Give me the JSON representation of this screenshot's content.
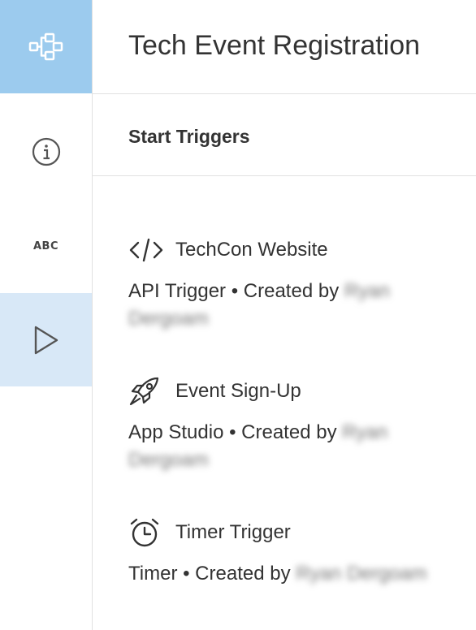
{
  "rail": {
    "items": [
      {
        "name": "workflow-icon",
        "selected": true
      },
      {
        "name": "info-icon",
        "selected": false
      },
      {
        "name": "abc-icon",
        "label": "ABC",
        "selected": false
      },
      {
        "name": "play-icon",
        "selected": true
      }
    ],
    "colors": {
      "active": "#9ccbee",
      "highlight": "#d8e8f7"
    }
  },
  "header": {
    "title": "Tech Event Registration"
  },
  "section": {
    "title": "Start Triggers"
  },
  "triggers": [
    {
      "icon": "code-icon",
      "name": "TechCon Website",
      "type": "API Trigger",
      "created_prefix": "• Created by",
      "creator": "Ryan Dergoam"
    },
    {
      "icon": "rocket-icon",
      "name": "Event Sign-Up",
      "type": "App Studio",
      "created_prefix": "• Created by",
      "creator": "Ryan Dergoam"
    },
    {
      "icon": "alarm-clock-icon",
      "name": "Timer Trigger",
      "type": "Timer",
      "created_prefix": "• Created by",
      "creator": "Ryan Dergoam"
    }
  ]
}
